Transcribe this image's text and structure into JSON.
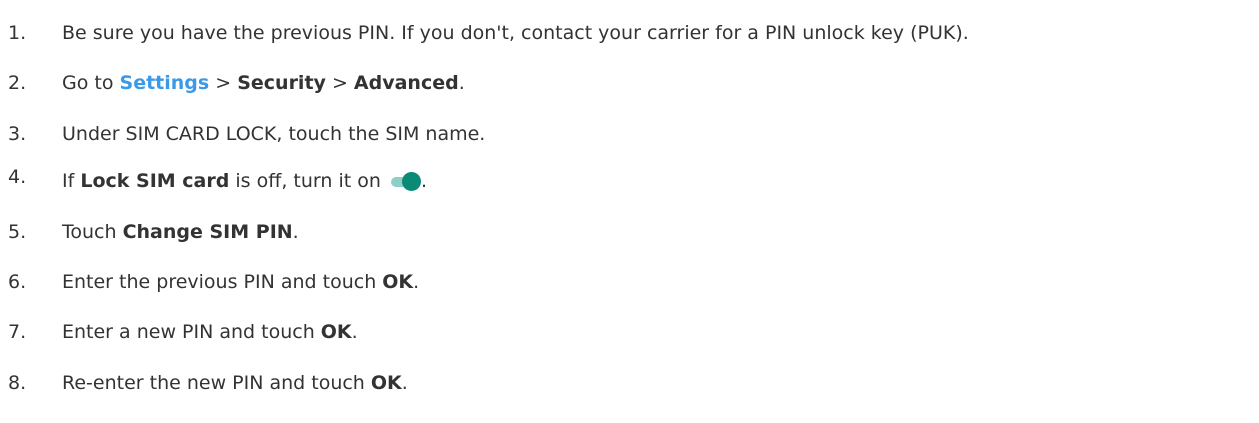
{
  "steps": [
    {
      "num": "1.",
      "text": "Be sure you have the previous PIN. If you don't, contact your carrier for a PIN unlock key (PUK)."
    },
    {
      "num": "2.",
      "prefix": "Go to ",
      "link": "Settings",
      "sep1": " > ",
      "bold1": "Security",
      "sep2": " > ",
      "bold2": "Advanced",
      "suffix": "."
    },
    {
      "num": "3.",
      "text": "Under SIM CARD LOCK, touch the SIM name."
    },
    {
      "num": "4.",
      "prefix": "If ",
      "bold": "Lock SIM card",
      "middle": " is off, turn it on ",
      "suffix": ".",
      "toggle_icon": "toggle-on-icon"
    },
    {
      "num": "5.",
      "prefix": "Touch ",
      "bold": "Change SIM PIN",
      "suffix": "."
    },
    {
      "num": "6.",
      "prefix": "Enter the previous PIN and touch ",
      "bold": "OK",
      "suffix": "."
    },
    {
      "num": "7.",
      "prefix": "Enter a new PIN and touch ",
      "bold": "OK",
      "suffix": "."
    },
    {
      "num": "8.",
      "prefix": "Re-enter the new PIN and touch ",
      "bold": "OK",
      "suffix": "."
    }
  ],
  "colors": {
    "text": "#333333",
    "link": "#3a9ae8",
    "toggle_thumb": "#0b8a78",
    "toggle_track": "#8fd0c6"
  }
}
